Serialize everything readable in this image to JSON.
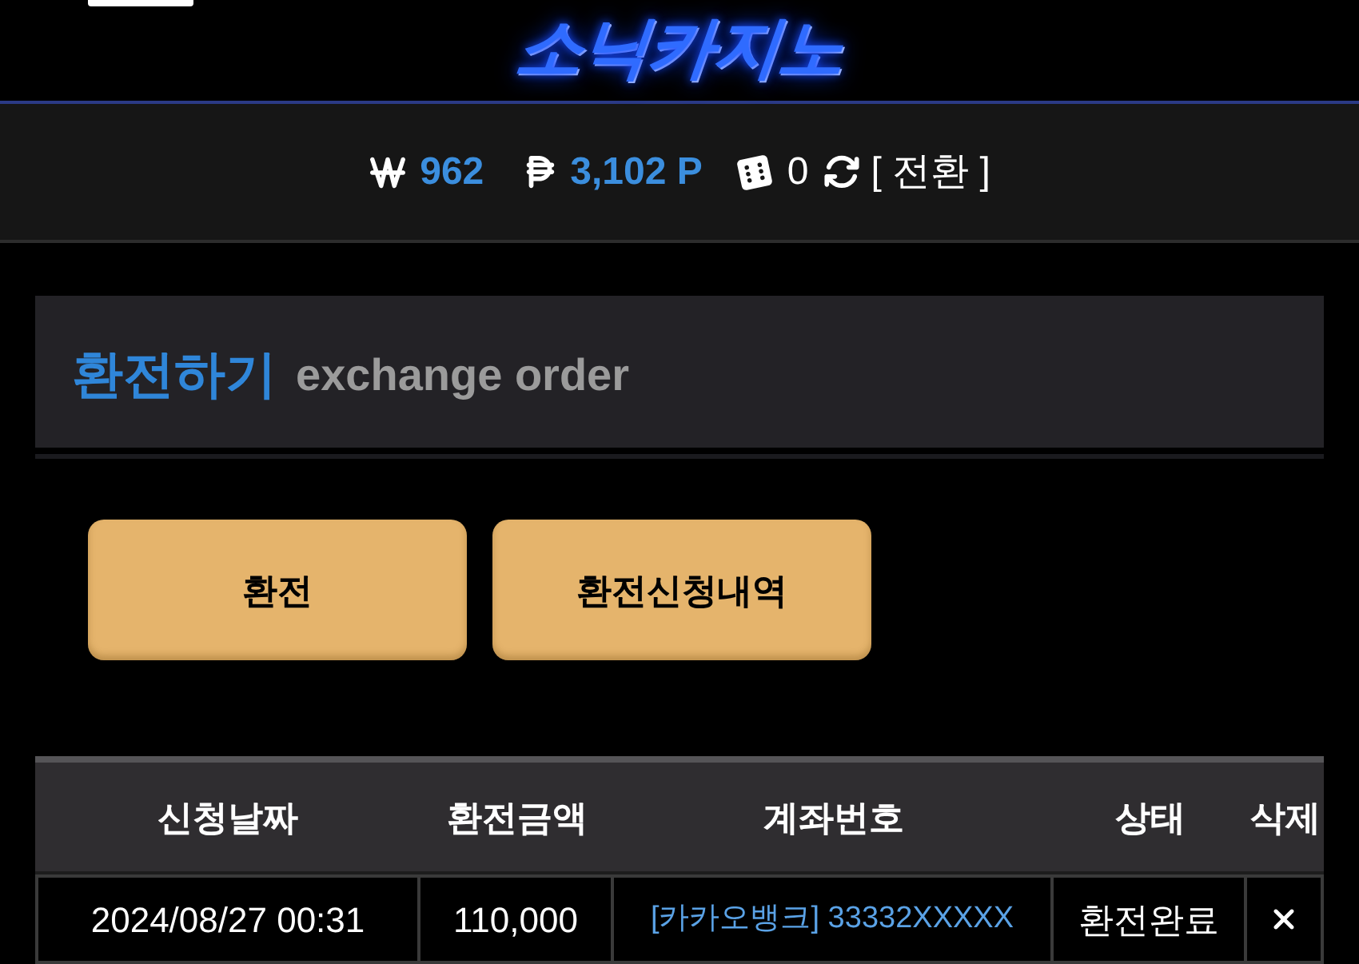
{
  "header": {
    "logo": "소닉카지노"
  },
  "balance_bar": {
    "items": [
      {
        "kind": "won",
        "value": "962"
      },
      {
        "kind": "point",
        "value": "3,102 P"
      },
      {
        "kind": "dice",
        "value": "0"
      }
    ],
    "convert_link": "[ 전환 ]"
  },
  "section": {
    "title": "환전하기",
    "subtitle": "exchange order"
  },
  "buttons": [
    "환전",
    "환전신청내역"
  ],
  "table": {
    "columns": [
      "신청날짜",
      "환전금액",
      "계좌번호",
      "상태",
      "삭제"
    ],
    "rows": [
      {
        "date": "2024/08/27 00:31",
        "amount": "110,000",
        "account": "[카카오뱅크] 33332XXXXX",
        "status": "환전완료"
      }
    ]
  }
}
